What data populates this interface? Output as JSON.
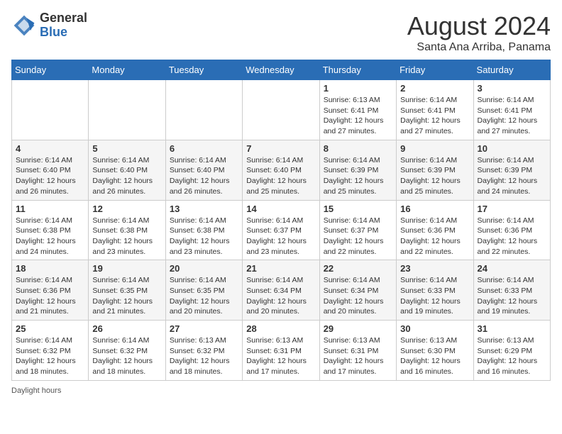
{
  "header": {
    "logo_general": "General",
    "logo_blue": "Blue",
    "month_title": "August 2024",
    "location": "Santa Ana Arriba, Panama"
  },
  "days_of_week": [
    "Sunday",
    "Monday",
    "Tuesday",
    "Wednesday",
    "Thursday",
    "Friday",
    "Saturday"
  ],
  "footer": {
    "daylight_label": "Daylight hours"
  },
  "weeks": [
    [
      {
        "day": "",
        "info": ""
      },
      {
        "day": "",
        "info": ""
      },
      {
        "day": "",
        "info": ""
      },
      {
        "day": "",
        "info": ""
      },
      {
        "day": "1",
        "info": "Sunrise: 6:13 AM\nSunset: 6:41 PM\nDaylight: 12 hours\nand 27 minutes."
      },
      {
        "day": "2",
        "info": "Sunrise: 6:14 AM\nSunset: 6:41 PM\nDaylight: 12 hours\nand 27 minutes."
      },
      {
        "day": "3",
        "info": "Sunrise: 6:14 AM\nSunset: 6:41 PM\nDaylight: 12 hours\nand 27 minutes."
      }
    ],
    [
      {
        "day": "4",
        "info": "Sunrise: 6:14 AM\nSunset: 6:40 PM\nDaylight: 12 hours\nand 26 minutes."
      },
      {
        "day": "5",
        "info": "Sunrise: 6:14 AM\nSunset: 6:40 PM\nDaylight: 12 hours\nand 26 minutes."
      },
      {
        "day": "6",
        "info": "Sunrise: 6:14 AM\nSunset: 6:40 PM\nDaylight: 12 hours\nand 26 minutes."
      },
      {
        "day": "7",
        "info": "Sunrise: 6:14 AM\nSunset: 6:40 PM\nDaylight: 12 hours\nand 25 minutes."
      },
      {
        "day": "8",
        "info": "Sunrise: 6:14 AM\nSunset: 6:39 PM\nDaylight: 12 hours\nand 25 minutes."
      },
      {
        "day": "9",
        "info": "Sunrise: 6:14 AM\nSunset: 6:39 PM\nDaylight: 12 hours\nand 25 minutes."
      },
      {
        "day": "10",
        "info": "Sunrise: 6:14 AM\nSunset: 6:39 PM\nDaylight: 12 hours\nand 24 minutes."
      }
    ],
    [
      {
        "day": "11",
        "info": "Sunrise: 6:14 AM\nSunset: 6:38 PM\nDaylight: 12 hours\nand 24 minutes."
      },
      {
        "day": "12",
        "info": "Sunrise: 6:14 AM\nSunset: 6:38 PM\nDaylight: 12 hours\nand 23 minutes."
      },
      {
        "day": "13",
        "info": "Sunrise: 6:14 AM\nSunset: 6:38 PM\nDaylight: 12 hours\nand 23 minutes."
      },
      {
        "day": "14",
        "info": "Sunrise: 6:14 AM\nSunset: 6:37 PM\nDaylight: 12 hours\nand 23 minutes."
      },
      {
        "day": "15",
        "info": "Sunrise: 6:14 AM\nSunset: 6:37 PM\nDaylight: 12 hours\nand 22 minutes."
      },
      {
        "day": "16",
        "info": "Sunrise: 6:14 AM\nSunset: 6:36 PM\nDaylight: 12 hours\nand 22 minutes."
      },
      {
        "day": "17",
        "info": "Sunrise: 6:14 AM\nSunset: 6:36 PM\nDaylight: 12 hours\nand 22 minutes."
      }
    ],
    [
      {
        "day": "18",
        "info": "Sunrise: 6:14 AM\nSunset: 6:36 PM\nDaylight: 12 hours\nand 21 minutes."
      },
      {
        "day": "19",
        "info": "Sunrise: 6:14 AM\nSunset: 6:35 PM\nDaylight: 12 hours\nand 21 minutes."
      },
      {
        "day": "20",
        "info": "Sunrise: 6:14 AM\nSunset: 6:35 PM\nDaylight: 12 hours\nand 20 minutes."
      },
      {
        "day": "21",
        "info": "Sunrise: 6:14 AM\nSunset: 6:34 PM\nDaylight: 12 hours\nand 20 minutes."
      },
      {
        "day": "22",
        "info": "Sunrise: 6:14 AM\nSunset: 6:34 PM\nDaylight: 12 hours\nand 20 minutes."
      },
      {
        "day": "23",
        "info": "Sunrise: 6:14 AM\nSunset: 6:33 PM\nDaylight: 12 hours\nand 19 minutes."
      },
      {
        "day": "24",
        "info": "Sunrise: 6:14 AM\nSunset: 6:33 PM\nDaylight: 12 hours\nand 19 minutes."
      }
    ],
    [
      {
        "day": "25",
        "info": "Sunrise: 6:14 AM\nSunset: 6:32 PM\nDaylight: 12 hours\nand 18 minutes."
      },
      {
        "day": "26",
        "info": "Sunrise: 6:14 AM\nSunset: 6:32 PM\nDaylight: 12 hours\nand 18 minutes."
      },
      {
        "day": "27",
        "info": "Sunrise: 6:13 AM\nSunset: 6:32 PM\nDaylight: 12 hours\nand 18 minutes."
      },
      {
        "day": "28",
        "info": "Sunrise: 6:13 AM\nSunset: 6:31 PM\nDaylight: 12 hours\nand 17 minutes."
      },
      {
        "day": "29",
        "info": "Sunrise: 6:13 AM\nSunset: 6:31 PM\nDaylight: 12 hours\nand 17 minutes."
      },
      {
        "day": "30",
        "info": "Sunrise: 6:13 AM\nSunset: 6:30 PM\nDaylight: 12 hours\nand 16 minutes."
      },
      {
        "day": "31",
        "info": "Sunrise: 6:13 AM\nSunset: 6:29 PM\nDaylight: 12 hours\nand 16 minutes."
      }
    ]
  ]
}
